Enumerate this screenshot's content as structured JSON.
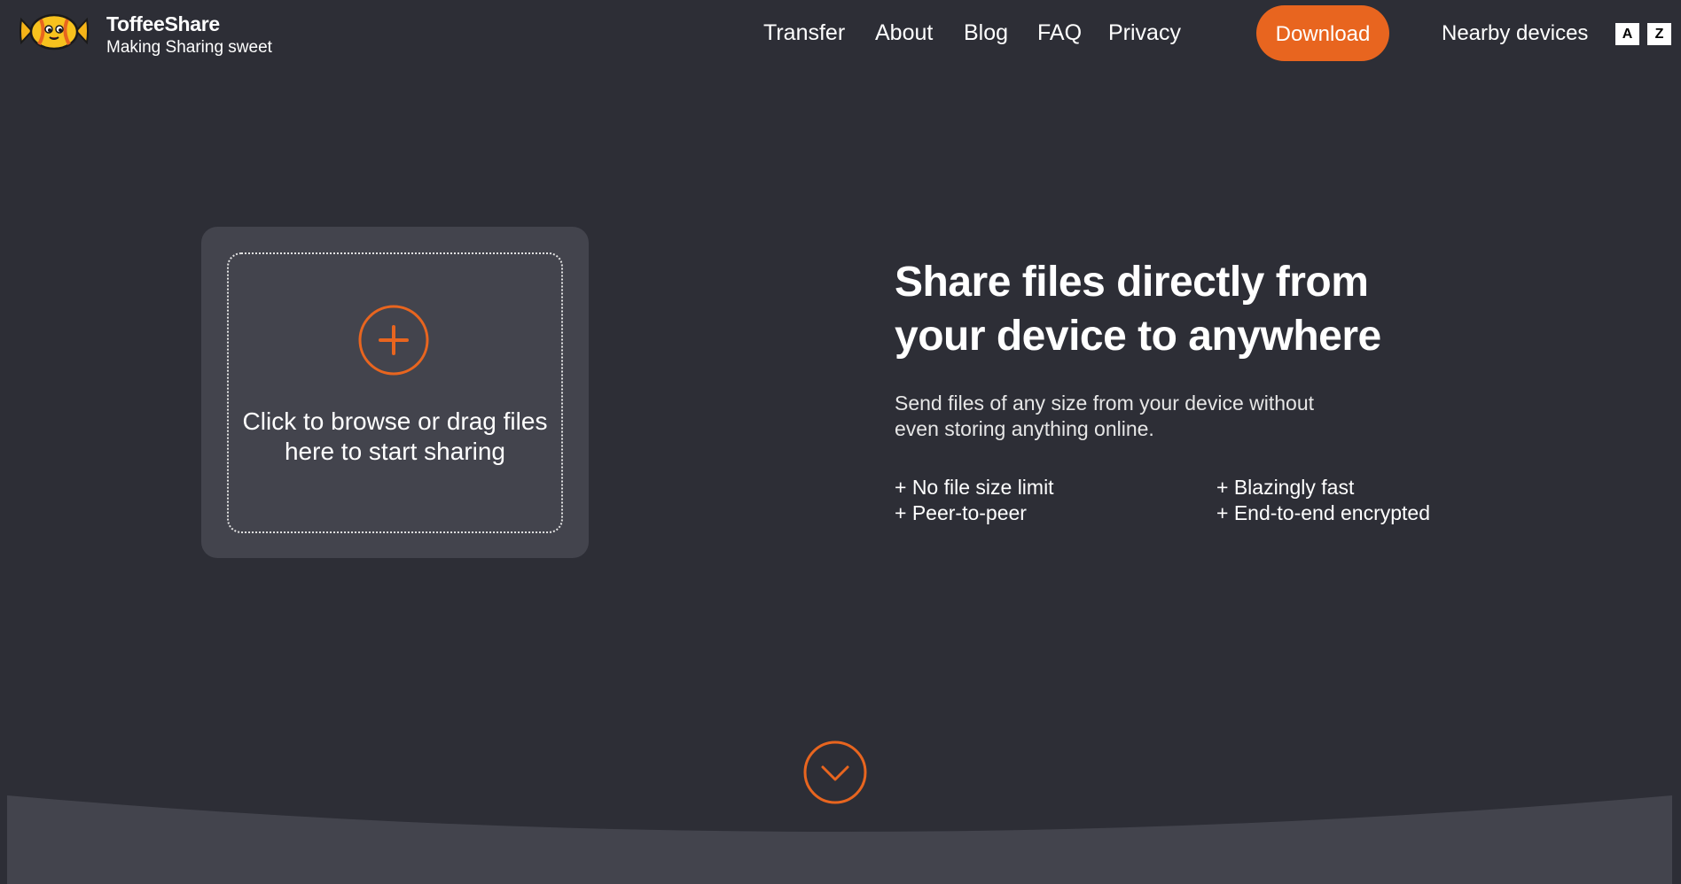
{
  "header": {
    "brand_name": "ToffeeShare",
    "tagline": "Making Sharing sweet",
    "logo_icon": "candy-icon",
    "nav": [
      {
        "label": "Transfer"
      },
      {
        "label": "About"
      },
      {
        "label": "Blog"
      },
      {
        "label": "FAQ"
      },
      {
        "label": "Privacy"
      }
    ],
    "download_label": "Download",
    "nearby_label": "Nearby devices",
    "lang_buttons": [
      "A",
      "Z"
    ]
  },
  "dropzone": {
    "icon": "plus-circle-icon",
    "line1": "Click to browse or drag files",
    "line2": "here to start sharing"
  },
  "hero": {
    "title_line1": "Share files directly from",
    "title_line2": "your device to anywhere",
    "subtitle_line1": "Send files of any size from your device without",
    "subtitle_line2": "even storing anything online.",
    "features": [
      "+ No file size limit",
      "+ Peer-to-peer",
      "+ Blazingly fast",
      "+ End-to-end encrypted"
    ]
  },
  "scroll_icon": "chevron-down-icon",
  "colors": {
    "background": "#2d2e36",
    "card": "#43444d",
    "accent": "#e8651f",
    "text": "#ffffff"
  }
}
